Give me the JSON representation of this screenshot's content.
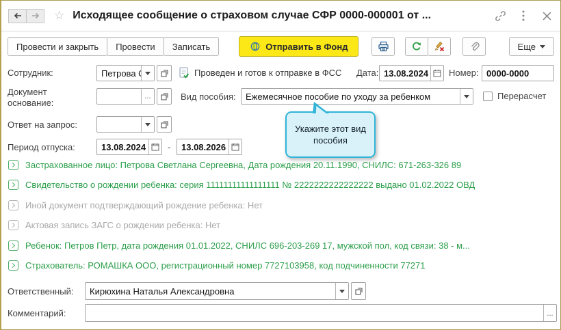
{
  "window": {
    "title": "Исходящее сообщение о страховом случае СФР 0000-000001 от ..."
  },
  "toolbar": {
    "post_and_close": "Провести и закрыть",
    "post": "Провести",
    "save": "Записать",
    "send_to_fund": "Отправить в Фонд",
    "more": "Еще"
  },
  "form": {
    "employee_label": "Сотрудник:",
    "employee_value": "Петрова С",
    "status_text": "Проведен и готов к отправке в ФСС",
    "date_label": "Дата:",
    "date_value": "13.08.2024",
    "number_label": "Номер:",
    "number_value": "0000-0000",
    "base_doc_label": "Документ основание:",
    "benefit_label": "Вид пособия:",
    "benefit_value": "Ежемесячное пособие по уходу за ребенком",
    "recalc_label": "Перерасчет",
    "reply_label": "Ответ на запрос:",
    "vacation_label": "Период отпуска:",
    "vacation_from": "13.08.2024",
    "vacation_dash": "-",
    "vacation_to": "13.08.2026",
    "responsible_label": "Ответственный:",
    "responsible_value": "Кирюхина Наталья Александровна",
    "comment_label": "Комментарий:",
    "comment_value": "",
    "ellipsis": "..."
  },
  "callout": {
    "text": "Укажите этот вид пособия"
  },
  "sections": [
    {
      "text": "Застрахованное лицо: Петрова Светлана Сергеевна, Дата рождения 20.11.1990, СНИЛС: 671-263-326 89",
      "state": "filled"
    },
    {
      "text": "Свидетельство о рождении ребенка: серия 11111111111111111 № 2222222222222222 выдано 01.02.2022 ОВД",
      "state": "filled"
    },
    {
      "text": "Иной документ подтверждающий рождение ребенка: Нет",
      "state": "empty"
    },
    {
      "text": "Актовая запись ЗАГС о рождении ребенка: Нет",
      "state": "empty"
    },
    {
      "text": "Ребенок: Петров Петр, дата рождения 01.01.2022, СНИЛС 696-203-269 17, мужской пол, код связи: 38 - м...",
      "state": "filled"
    },
    {
      "text": "Страхователь: РОМАШКА ООО, регистрационный номер 7727103958, код подчиненности 77271",
      "state": "filled"
    }
  ],
  "colors": {
    "accent_yellow": "#fbe816",
    "green_text": "#2b9e4a",
    "gray_text": "#a8a8a8",
    "callout_bg": "#d9f2fa",
    "callout_border": "#30b4d8"
  }
}
